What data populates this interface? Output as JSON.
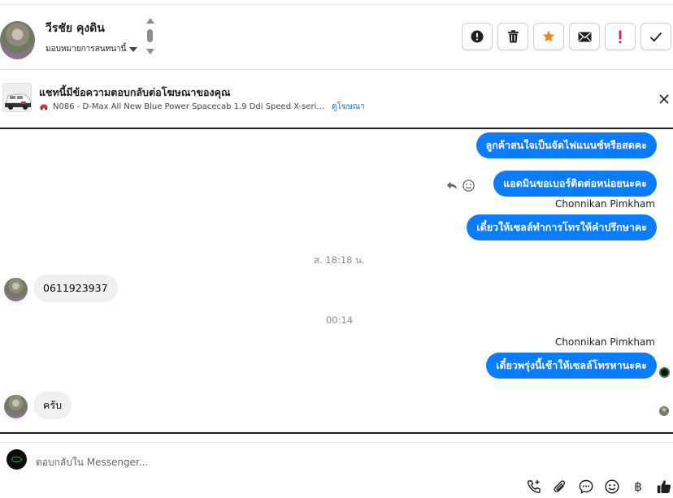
{
  "header": {
    "contact_name": "วีรชัย คุงดิน",
    "assign_label": "มอบหมายการสนทนานี้",
    "actions": [
      {
        "name": "report-spam-button",
        "icon": "alert-circle-icon"
      },
      {
        "name": "delete-button",
        "icon": "trash-icon"
      },
      {
        "name": "star-button",
        "icon": "star-icon",
        "color": "#f5821f"
      },
      {
        "name": "mark-unread-button",
        "icon": "envelope-icon"
      },
      {
        "name": "mark-important-button",
        "icon": "exclamation-icon",
        "color": "#e41e3f"
      },
      {
        "name": "mark-done-button",
        "icon": "check-icon"
      }
    ]
  },
  "ad_banner": {
    "title": "แชทนี้มีข้อความตอบกลับต่อโฆษณาของคุณ",
    "ad_name": "N086 - D-Max All New Blue Power Spacecab 1.9 Ddi Speed X-seri...",
    "view_ad_link": "ดูโฆษณา"
  },
  "messages": {
    "m1": "ลูกค้าสนใจเป็นจัดไฟแนนซ์หรือสดคะ",
    "m2": "แอดมินขอเบอร์ติดต่อหน่อยนะคะ",
    "sender1": "Chonnikan Pimkham",
    "m3": "เดี๋ยวให้เซลล์ทำการโทรให้คำปรึกษาคะ",
    "time1": "ส. 18:18 น.",
    "m4": "0611923937",
    "time2": "00:14",
    "sender2": "Chonnikan Pimkham",
    "m5": "เดี๋ยวพรุ่งนี้เช้าให้เซลล์โทรหานะคะ",
    "m6": "ครับ"
  },
  "composer": {
    "placeholder": "ตอบกลับใน Messenger...",
    "tools": [
      "phone-plus-icon",
      "paperclip-icon",
      "saved-reply-icon",
      "emoji-icon",
      "baht-icon",
      "thumbs-up-icon"
    ],
    "baht_symbol": "฿"
  },
  "colors": {
    "accent": "#0a7cff",
    "incoming_bubble": "#f0f0f0",
    "star": "#f5821f",
    "important": "#e41e3f"
  }
}
